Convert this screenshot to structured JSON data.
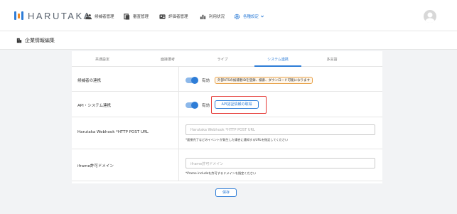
{
  "app": {
    "logo_text": "HARUTAKA"
  },
  "nav": {
    "items": [
      {
        "label": "候補者管理",
        "icon": "people-icon"
      },
      {
        "label": "審査管理",
        "icon": "document-stack-icon"
      },
      {
        "label": "評価者管理",
        "icon": "person-card-icon"
      },
      {
        "label": "利用状況",
        "icon": "bar-chart-icon"
      },
      {
        "label": "各種設定",
        "icon": "gear-icon",
        "dropdown": "chevron-down-icon",
        "active": true
      }
    ],
    "avatar_icon": "user-avatar-icon"
  },
  "page": {
    "title": "企業情報編集",
    "title_icon": "building-icon"
  },
  "tabs": [
    "共通設定",
    "面接選考",
    "ライブ",
    "システム連携",
    "多言語"
  ],
  "active_tab": 3,
  "rows": {
    "candidate_link": {
      "label": "候補者の連携",
      "toggle_state": "有効",
      "note": "外部ATSの候補者IDを登録、検索、ダウンロード可能になります"
    },
    "api_link": {
      "label": "API・システム連携",
      "toggle_state": "有効",
      "button": "API認証情報の取得"
    },
    "webhook": {
      "label": "Harutaka Webhook *HTTP POST URL",
      "placeholder": "Harutaka Webhook *HTTP POST URL",
      "help": "*面接完了などのイベントが発生した場合に通知するURLを指定してください"
    },
    "iframe": {
      "label": "iframe許可ドメイン",
      "placeholder": "iframe許可ドメイン",
      "help": "*iframe includeを許可するドメインを指定ください"
    }
  },
  "save_label": "保存",
  "colors": {
    "accent": "#2e7dd7",
    "highlight": "#e53935",
    "note_border": "#e8a24a"
  }
}
